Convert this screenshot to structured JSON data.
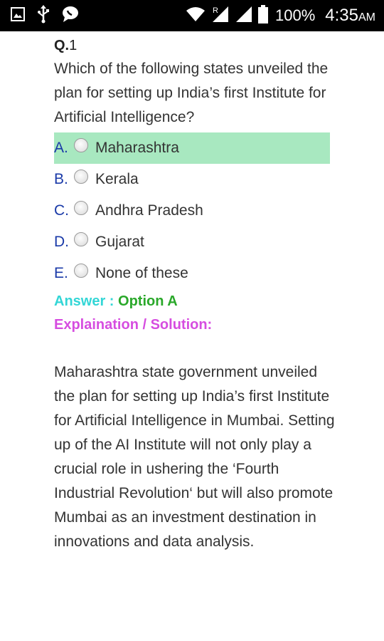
{
  "status_bar": {
    "battery_percent": "100%",
    "time": "4:35",
    "ampm": "AM"
  },
  "question": {
    "label": "Q.",
    "number": "1",
    "text": "Which of the following states unveiled the plan for setting up India’s first Institute for Artificial Intelligence?"
  },
  "options": [
    {
      "letter": "A.",
      "text": "Maharashtra",
      "selected": true
    },
    {
      "letter": "B.",
      "text": "Kerala",
      "selected": false
    },
    {
      "letter": "C.",
      "text": "Andhra Pradesh",
      "selected": false
    },
    {
      "letter": "D.",
      "text": "Gujarat",
      "selected": false
    },
    {
      "letter": "E.",
      "text": "None of these",
      "selected": false
    }
  ],
  "answer": {
    "label": "Answer : ",
    "value": "Option A"
  },
  "explanation": {
    "title": "Explaination / Solution:",
    "text": "Maharashtra state government unveiled the plan for setting up India’s first Institute for Artificial Intelligence in Mumbai. Setting up of the AI Institute will not only play a crucial role in ushering the ‘Fourth Industrial Revolution‘ but will also promote Mumbai as an investment destination in innovations and data analysis."
  },
  "colors": {
    "selected_option_bg": "#a8e8c0",
    "option_letter": "#1a3aa8",
    "answer_label": "#33d6d6",
    "answer_value": "#2aa82a",
    "explanation_title": "#d64de0"
  },
  "icons": [
    "image-icon",
    "usb-icon",
    "chat-icon",
    "wifi-icon",
    "signal-roaming-icon",
    "signal-icon",
    "battery-icon"
  ]
}
